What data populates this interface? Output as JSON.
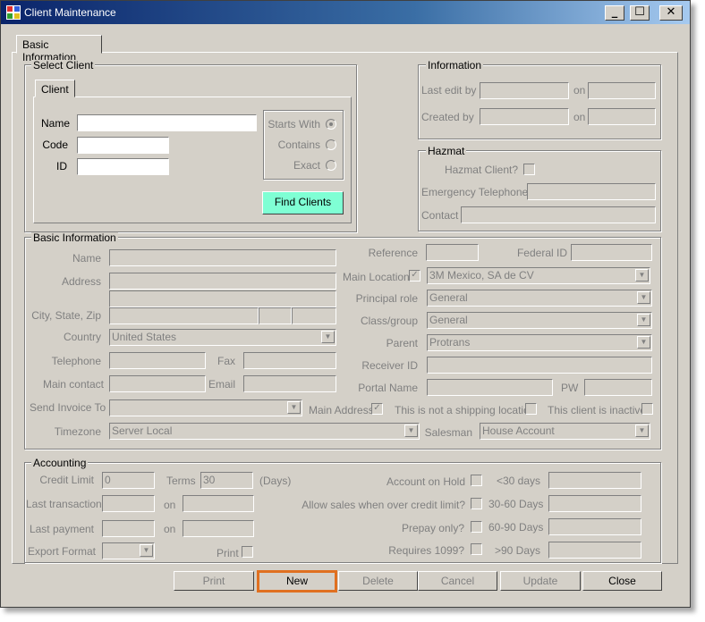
{
  "window": {
    "title": "Client Maintenance",
    "min": "_",
    "max": "☐",
    "close": "✕"
  },
  "tabs": {
    "main": "Basic Information",
    "client": "Client"
  },
  "select_client": {
    "legend": "Select Client",
    "name_label": "Name",
    "name_value": "",
    "code_label": "Code",
    "code_value": "",
    "id_label": "ID",
    "id_value": "",
    "starts_with": "Starts With",
    "contains": "Contains",
    "exact": "Exact",
    "selected_mode": "Starts With",
    "find_button": "Find Clients"
  },
  "information": {
    "legend": "Information",
    "last_edit_label": "Last edit by",
    "on1": "on",
    "created_label": "Created by",
    "on2": "on"
  },
  "hazmat": {
    "legend": "Hazmat",
    "client_label": "Hazmat Client?",
    "emergency_label": "Emergency Telephone",
    "contact_label": "Contact"
  },
  "basic": {
    "legend": "Basic Information",
    "name": "Name",
    "address": "Address",
    "city": "City, State, Zip",
    "country": "Country",
    "country_value": "United States",
    "telephone": "Telephone",
    "fax": "Fax",
    "main_contact": "Main contact",
    "email": "Email",
    "send_invoice": "Send Invoice To",
    "main_address": "Main Address",
    "not_shipping": "This is not a shipping location",
    "inactive": "This client is inactive",
    "timezone": "Timezone",
    "timezone_value": "Server Local",
    "reference": "Reference",
    "federal_id": "Federal ID",
    "main_location": "Main Location",
    "main_location_value": "3M Mexico, SA de CV",
    "principal_role": "Principal role",
    "principal_role_value": "General",
    "class_group": "Class/group",
    "class_group_value": "General",
    "parent": "Parent",
    "parent_value": "Protrans",
    "receiver_id": "Receiver ID",
    "portal_name": "Portal Name",
    "pw": "PW",
    "salesman": "Salesman",
    "salesman_value": "House Account",
    "main_location_checked": true,
    "main_address_checked": true
  },
  "accounting": {
    "legend": "Accounting",
    "credit_limit": "Credit Limit",
    "credit_limit_value": "0",
    "terms": "Terms",
    "terms_value": "30",
    "days": "(Days)",
    "last_transaction": "Last transaction",
    "on1": "on",
    "last_payment": "Last payment",
    "on2": "on",
    "export_format": "Export Format",
    "print": "Print",
    "on_hold": "Account on Hold",
    "over_limit": "Allow sales when over credit limit?",
    "prepay": "Prepay only?",
    "req1099": "Requires 1099?",
    "d30": "<30 days",
    "d3060": "30-60 Days",
    "d6090": "60-90 Days",
    "d90": ">90 Days"
  },
  "buttons": {
    "print": "Print",
    "new": "New",
    "delete": "Delete",
    "cancel": "Cancel",
    "update": "Update",
    "close": "Close"
  },
  "colors": {
    "face": "#d4d0c8",
    "title_start": "#0a246a",
    "find_button": "#7fffd4",
    "highlight": "#e07020"
  }
}
